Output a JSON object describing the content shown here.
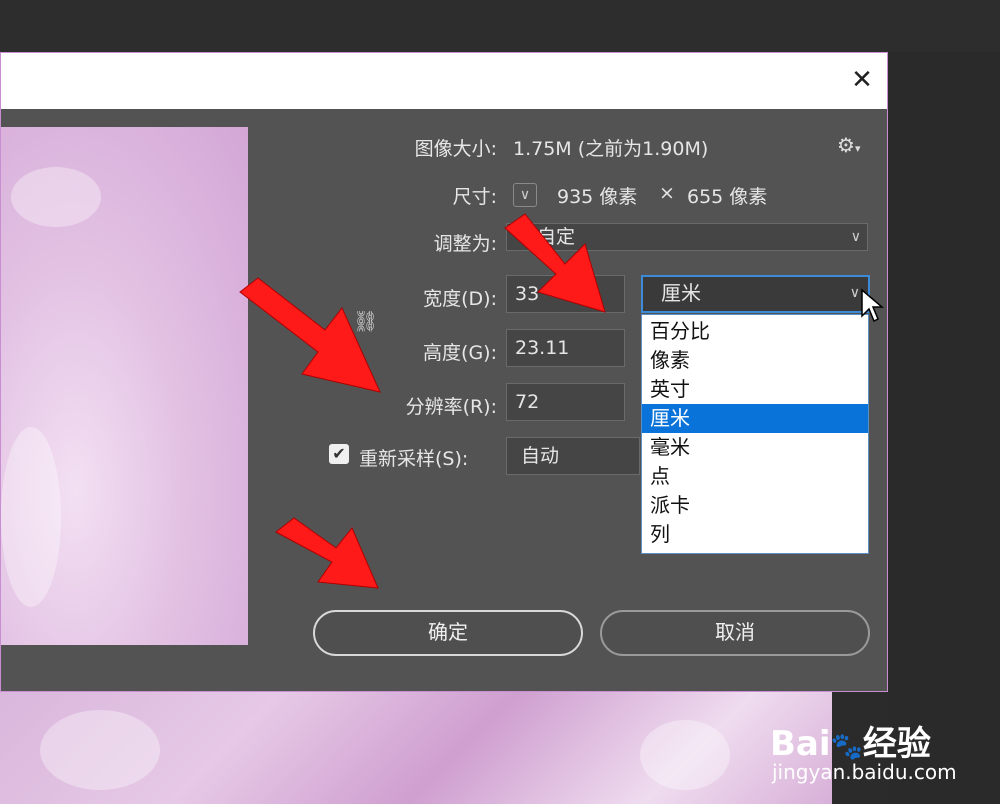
{
  "dialog": {
    "close_icon": "close-icon",
    "settings_icon": "gear-icon"
  },
  "image_size": {
    "label": "图像大小:",
    "value": "1.75M (之前为1.90M)"
  },
  "dimensions": {
    "label": "尺寸:",
    "width": "935 像素",
    "times": "×",
    "height": "655 像素"
  },
  "fit_to": {
    "label": "调整为:",
    "value": "自定"
  },
  "width": {
    "label": "宽度(D):",
    "value": "33"
  },
  "height": {
    "label": "高度(G):",
    "value": "23.11"
  },
  "resolution": {
    "label": "分辨率(R):",
    "value": "72"
  },
  "resample": {
    "label": "重新采样(S):",
    "checked": true,
    "value": "自动"
  },
  "unit_select": {
    "value": "厘米",
    "options": [
      "百分比",
      "像素",
      "英寸",
      "厘米",
      "毫米",
      "点",
      "派卡",
      "列"
    ],
    "selected_index": 3
  },
  "buttons": {
    "ok": "确定",
    "cancel": "取消"
  },
  "watermark": {
    "brand": "Bai",
    "brand_suffix": "经验",
    "url": "jingyan.baidu.com"
  },
  "colors": {
    "arrow": "#ff1a1a",
    "selection": "#0a73d9",
    "dialog_bg": "#535353"
  }
}
